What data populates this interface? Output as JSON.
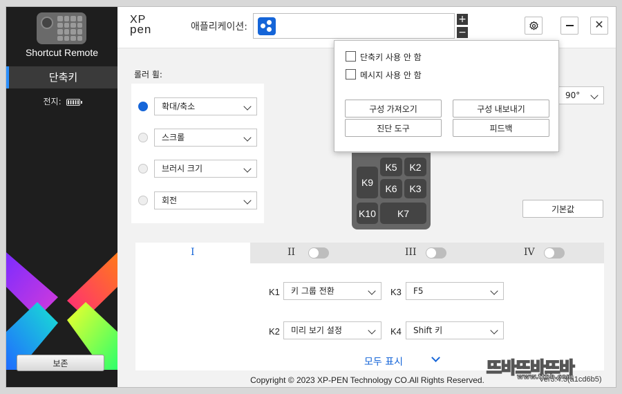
{
  "sidebar": {
    "device_name": "Shortcut Remote",
    "nav_item": "단축키",
    "battery_label": "전지:",
    "save_label": "보존"
  },
  "header": {
    "logo_line1": "XP",
    "logo_line2": "pen",
    "app_label": "애플리케이션:",
    "plus": "+",
    "minus": "−",
    "settings_icon": "gear-icon",
    "minimize_icon": "minimize-icon",
    "close_icon": "close-icon"
  },
  "roller": {
    "label": "롤러 휠:",
    "rows": [
      {
        "value": "확대/축소",
        "selected": true
      },
      {
        "value": "스크롤",
        "selected": false
      },
      {
        "value": "브러시 크기",
        "selected": false
      },
      {
        "value": "회전",
        "selected": false
      }
    ]
  },
  "rotation_select": "90°",
  "default_button": "기본값",
  "keypad": {
    "keys": [
      "K5",
      "K2",
      "K9",
      "K6",
      "K3",
      "K10",
      "K7"
    ]
  },
  "tabs": [
    {
      "label": "I",
      "active": true
    },
    {
      "label": "II",
      "active": false
    },
    {
      "label": "III",
      "active": false
    },
    {
      "label": "IV",
      "active": false
    }
  ],
  "key_settings": [
    {
      "key": "K1",
      "value": "키 그룹 전환"
    },
    {
      "key": "K3",
      "value": "F5"
    },
    {
      "key": "K2",
      "value": "미리 보기 설정"
    },
    {
      "key": "K4",
      "value": "Shift 키"
    }
  ],
  "show_all": "모두 표시",
  "footer": {
    "copyright": "Copyright © 2023  XP-PEN Technology CO.All Rights Reserved.",
    "version": "Ver3.4.3(a1cd6b5)"
  },
  "popup": {
    "checkbox1": "단축키 사용 안 함",
    "checkbox2": "메시지 사용 안 함",
    "import_config": "구성 가져오기",
    "export_config": "구성 내보내기",
    "diagnostic_tool": "진단 도구",
    "feedback": "피드백"
  },
  "watermark": {
    "text": "뜨바뜨바뜨바",
    "sub": "www.ttbb.com"
  }
}
